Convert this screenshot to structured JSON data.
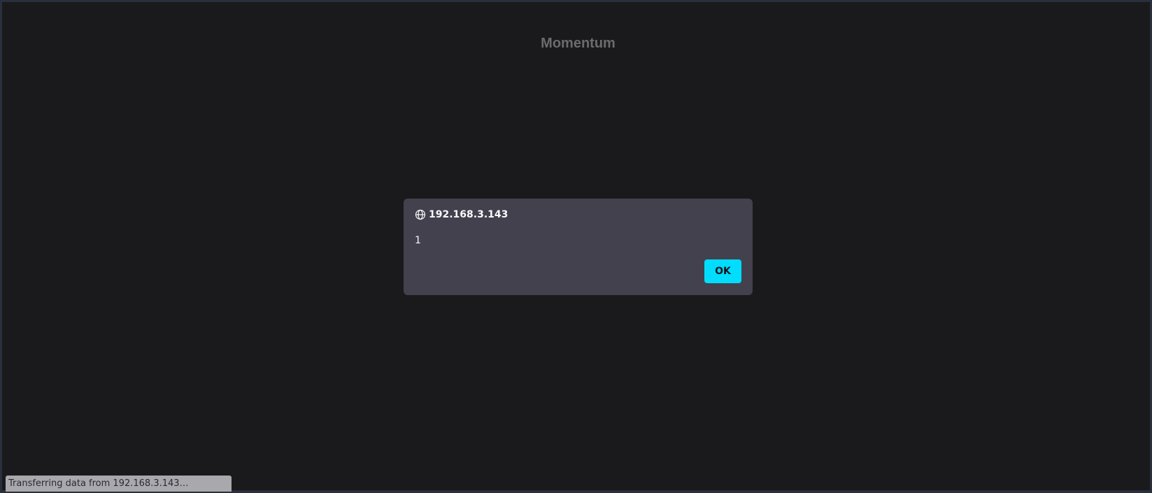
{
  "page": {
    "title": "Momentum"
  },
  "dialog": {
    "icon": "globe-icon",
    "origin": "192.168.3.143",
    "message": "1",
    "ok_label": "OK",
    "accent_color": "#00ddff"
  },
  "status_bar": {
    "text": "Transferring data from 192.168.3.143…"
  }
}
